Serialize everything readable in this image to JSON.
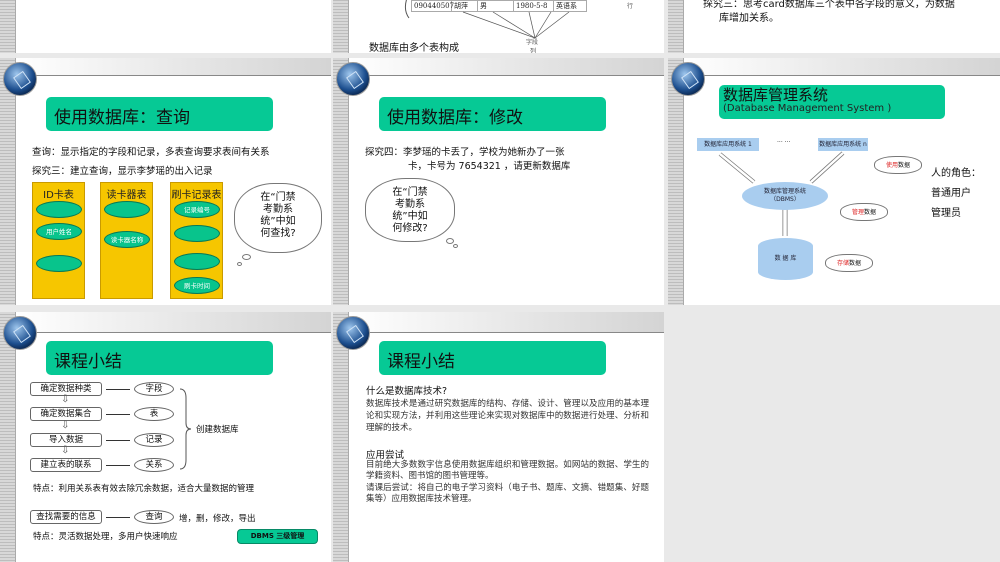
{
  "slides": [
    {
      "id": 1
    },
    {
      "id": 2,
      "table_row": [
        "090440507",
        "胡萍",
        "男",
        "1980-5-8",
        "英语系"
      ],
      "field_label": "字段",
      "column_label": "列",
      "row_label": "行",
      "caption": "数据库由多个表构成"
    },
    {
      "id": 3,
      "line1": "探究三：思考card数据库三个表中各字段的意义，为数据",
      "line2": "库增加关系。"
    },
    {
      "id": 4,
      "title": "使用数据库：查询",
      "line1": "查询：显示指定的字段和记录，多表查询要求表间有关系",
      "line2": "探究三：建立查询，显示李梦瑶的出入记录",
      "tables": [
        {
          "name": "ID卡表",
          "fields": [
            "",
            "用户姓名",
            ""
          ]
        },
        {
          "name": "读卡器表",
          "fields": [
            "",
            "读卡器名称"
          ]
        },
        {
          "name": "刷卡记录表",
          "fields": [
            "记录编号",
            "",
            "",
            "刷卡时间"
          ]
        }
      ],
      "cloud": [
        "在“门禁",
        "考勤系",
        "统”中如",
        "何查找?"
      ]
    },
    {
      "id": 5,
      "title": "使用数据库：修改",
      "line1": "探究四：李梦瑶的卡丢了，学校为她新办了一张",
      "line2": "卡，卡号为 7654321 ，请更新数据库",
      "cloud": [
        "在“门禁",
        "考勤系",
        "统”中如",
        "何修改?"
      ]
    },
    {
      "id": 6,
      "title": "数据库管理系统",
      "subtitle": "(Database Management System )",
      "app1": "数据库应用系统 1",
      "ellipsis": "··· ···",
      "appn": "数据库应用系统 n",
      "dbms": [
        "数据库管理系统",
        "（DBMS）"
      ],
      "db": "数 据 库",
      "clouds": [
        {
          "red": "使用",
          "rest": "数据"
        },
        {
          "red": "管理",
          "rest": "数据"
        },
        {
          "red": "存储",
          "rest": "数据"
        }
      ],
      "roles": [
        "人的角色：",
        "普通用户",
        "管理员"
      ]
    },
    {
      "id": 7,
      "title": "课程小结",
      "steps": [
        "确定数据种类",
        "确定数据集合",
        "导入数据",
        "建立表的联系"
      ],
      "results": [
        "字段",
        "表",
        "记录",
        "关系"
      ],
      "brace_label": "创建数据库",
      "feature1": "特点：利用关系表有效去除冗余数据，适合大量数据的管理",
      "find": "查找需要的信息",
      "query": "查询",
      "ops": "增，删，修改，导出",
      "feature2": "特点：灵活数据处理，多用户快速响应",
      "callout": "DBMS 三级管理"
    },
    {
      "id": 8,
      "title": "课程小结",
      "h1": "什么是数据库技术?",
      "p1": "数据库技术是通过研究数据库的结构、存储、设计、管理以及应用的基本理论和实现方法，并利用这些理论来实现对数据库中的数据进行处理、分析和理解的技术。",
      "h2": "应用尝试",
      "p2": "目前绝大多数数字信息使用数据库组织和管理数据。如网站的数据、学生的学籍资料、图书馆的图书管理等。",
      "p3": "请课后尝试：将自己的电子学习资料（电子书、题库、文摘、错题集、好题集等）应用数据库技术管理。"
    }
  ],
  "colors": {
    "title_green": "#06c995",
    "table_yellow": "#f6c600",
    "ellipse_green": "#08c48c",
    "diagram_blue": "#a9cdef"
  }
}
